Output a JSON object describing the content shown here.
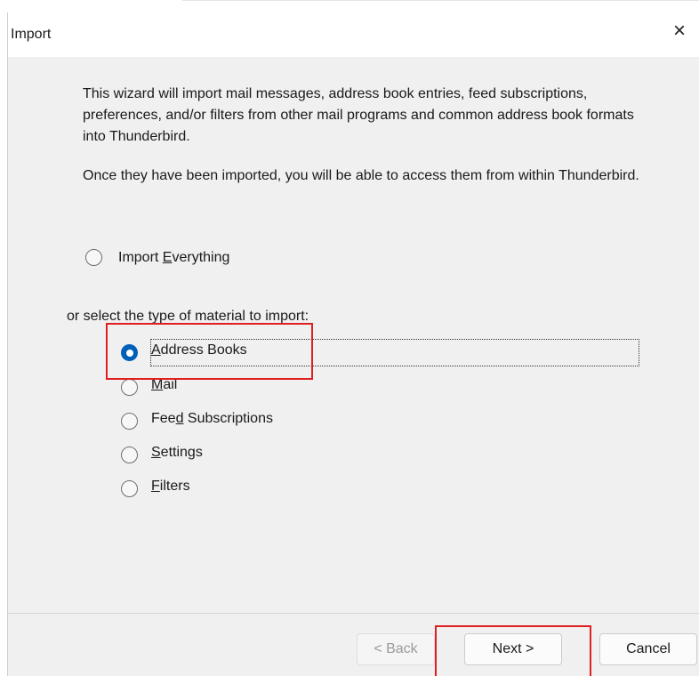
{
  "window": {
    "title": "Import",
    "close_symbol": "×"
  },
  "intro": {
    "paragraph1": "This wizard will import mail messages, address book entries, feed subscriptions, preferences, and/or filters from other mail programs and common address book formats into Thunderbird.",
    "paragraph2": "Once they have been imported, you will be able to access them from within Thunderbird."
  },
  "import_everything": {
    "pre": "Import ",
    "accel": "E",
    "post": "verything",
    "checked": false
  },
  "select_prompt": "or select the type of material to import:",
  "types": [
    {
      "pre": "",
      "accel": "A",
      "post": "ddress Books",
      "checked": true
    },
    {
      "pre": "",
      "accel": "M",
      "post": "ail",
      "checked": false
    },
    {
      "pre": "Fee",
      "accel": "d",
      "post": " Subscriptions",
      "checked": false
    },
    {
      "pre": "",
      "accel": "S",
      "post": "ettings",
      "checked": false
    },
    {
      "pre": "",
      "accel": "F",
      "post": "ilters",
      "checked": false
    }
  ],
  "buttons": {
    "back": "< Back",
    "next": "Next >",
    "cancel": "Cancel"
  },
  "colors": {
    "accent": "#005fb8",
    "highlight": "#e02020",
    "dialog_bg": "#f0f0f0"
  },
  "icons": {
    "close": "close-icon"
  }
}
